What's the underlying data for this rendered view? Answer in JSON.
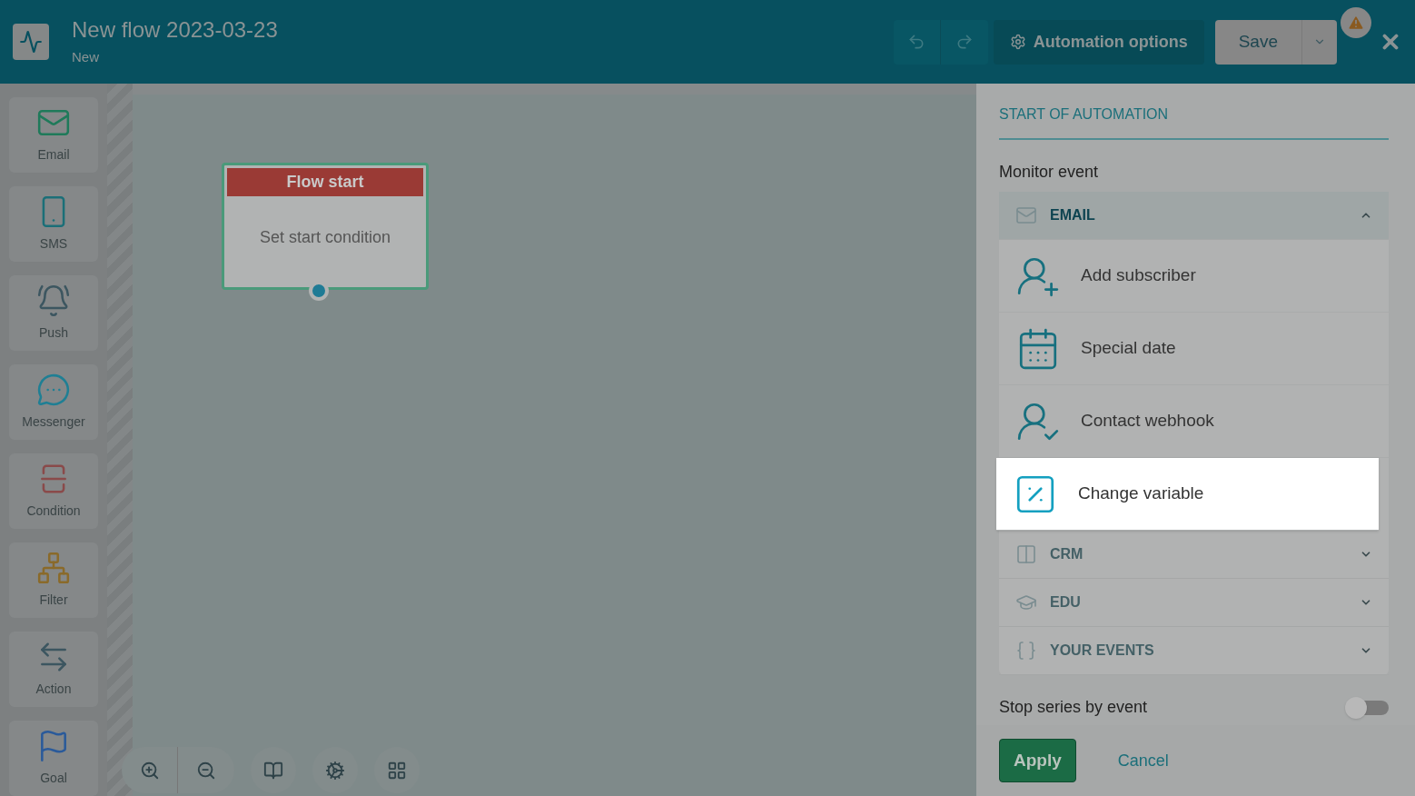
{
  "header": {
    "title": "New flow 2023-03-23",
    "subtitle": "New",
    "options_button": "Automation options",
    "save_button": "Save"
  },
  "palette": [
    {
      "label": "Email",
      "color": "#1f7a5a"
    },
    {
      "label": "SMS",
      "color": "#1b6f78"
    },
    {
      "label": "Push",
      "color": "#3c5660"
    },
    {
      "label": "Messenger",
      "color": "#1f7f94"
    },
    {
      "label": "Condition",
      "color": "#8a4a4a"
    },
    {
      "label": "Filter",
      "color": "#8a6a2a"
    },
    {
      "label": "Action",
      "color": "#3c5660"
    },
    {
      "label": "Goal",
      "color": "#2a5a9a"
    }
  ],
  "node": {
    "title": "Flow start",
    "body": "Set start condition"
  },
  "panel": {
    "section_title": "START OF AUTOMATION",
    "monitor_label": "Monitor event",
    "groups": [
      {
        "label": "EMAIL",
        "expanded": true,
        "items": [
          {
            "label": "Add subscriber",
            "highlighted": false
          },
          {
            "label": "Special date",
            "highlighted": false
          },
          {
            "label": "Contact webhook",
            "highlighted": false
          },
          {
            "label": "Change variable",
            "highlighted": true
          }
        ]
      },
      {
        "label": "CRM",
        "expanded": false
      },
      {
        "label": "EDU",
        "expanded": false
      },
      {
        "label": "YOUR EVENTS",
        "expanded": false
      }
    ],
    "stop_label": "Stop series by event",
    "stop_on": false,
    "apply": "Apply",
    "cancel": "Cancel"
  }
}
